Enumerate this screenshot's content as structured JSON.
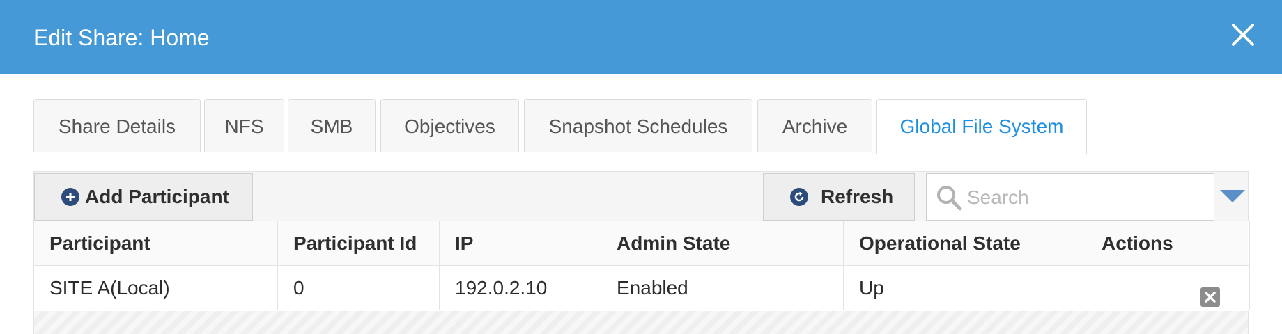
{
  "dialog": {
    "title": "Edit Share: Home",
    "close_icon": "close-icon"
  },
  "tabs": [
    {
      "label": "Share Details",
      "active": false
    },
    {
      "label": "NFS",
      "active": false
    },
    {
      "label": "SMB",
      "active": false
    },
    {
      "label": "Objectives",
      "active": false
    },
    {
      "label": "Snapshot Schedules",
      "active": false
    },
    {
      "label": "Archive",
      "active": false
    },
    {
      "label": "Global File System",
      "active": true
    }
  ],
  "toolbar": {
    "add_label": "Add Participant",
    "add_icon": "plus-circle-icon",
    "refresh_label": "Refresh",
    "refresh_icon": "refresh-icon",
    "search_placeholder": "Search",
    "search_icon": "search-icon",
    "dropdown_icon": "chevron-down-icon"
  },
  "table": {
    "columns": [
      "Participant",
      "Participant Id",
      "IP",
      "Admin State",
      "Operational State",
      "Actions"
    ],
    "rows": [
      {
        "participant": "SITE A(Local)",
        "participant_id": "0",
        "ip": "192.0.2.10",
        "admin_state": "Enabled",
        "operational_state": "Up",
        "action_icon": "delete-icon"
      }
    ]
  },
  "colors": {
    "header_bg": "#4499d6",
    "active_tab": "#1e8fe0",
    "button_icon": "#2c4c7c"
  }
}
